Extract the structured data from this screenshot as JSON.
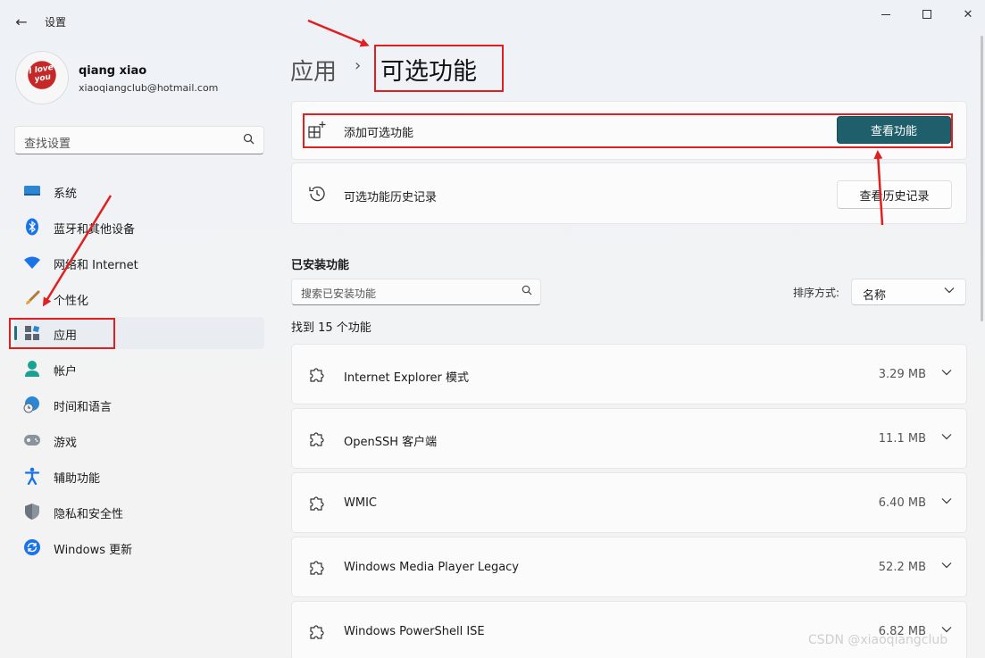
{
  "window": {
    "title": "设置",
    "controls": {
      "minimize": "minimize",
      "maximize": "maximize",
      "close": "✕"
    }
  },
  "profile": {
    "name": "qiang xiao",
    "email": "xiaoqiangclub@hotmail.com",
    "avatar_text": "I love you"
  },
  "sidebar": {
    "search_placeholder": "查找设置",
    "items": [
      {
        "label": "系统",
        "icon": "monitor-icon"
      },
      {
        "label": "蓝牙和其他设备",
        "icon": "bluetooth-icon"
      },
      {
        "label": "网络和 Internet",
        "icon": "wifi-icon"
      },
      {
        "label": "个性化",
        "icon": "brush-icon"
      },
      {
        "label": "应用",
        "icon": "apps-icon",
        "active": true
      },
      {
        "label": "帐户",
        "icon": "account-icon"
      },
      {
        "label": "时间和语言",
        "icon": "globe-clock-icon"
      },
      {
        "label": "游戏",
        "icon": "gamepad-icon"
      },
      {
        "label": "辅助功能",
        "icon": "accessibility-icon"
      },
      {
        "label": "隐私和安全性",
        "icon": "shield-icon"
      },
      {
        "label": "Windows 更新",
        "icon": "update-icon"
      }
    ]
  },
  "breadcrumb": {
    "parent": "应用",
    "separator": "›",
    "current": "可选功能"
  },
  "add_feature": {
    "label": "添加可选功能",
    "button": "查看功能"
  },
  "history": {
    "label": "可选功能历史记录",
    "button": "查看历史记录"
  },
  "installed": {
    "title": "已安装功能",
    "search_placeholder": "搜索已安装功能",
    "sort_label": "排序方式:",
    "sort_value": "名称",
    "found": "找到 15 个功能",
    "features": [
      {
        "name": "Internet Explorer 模式",
        "size": "3.29 MB"
      },
      {
        "name": "OpenSSH 客户端",
        "size": "11.1 MB"
      },
      {
        "name": "WMIC",
        "size": "6.40 MB"
      },
      {
        "name": "Windows Media Player Legacy",
        "size": "52.2 MB"
      },
      {
        "name": "Windows PowerShell ISE",
        "size": "6.82 MB"
      }
    ]
  },
  "watermark": "CSDN @xiaoqiangclub",
  "colors": {
    "accent": "#1f5f6b",
    "annotation": "#e02020"
  }
}
